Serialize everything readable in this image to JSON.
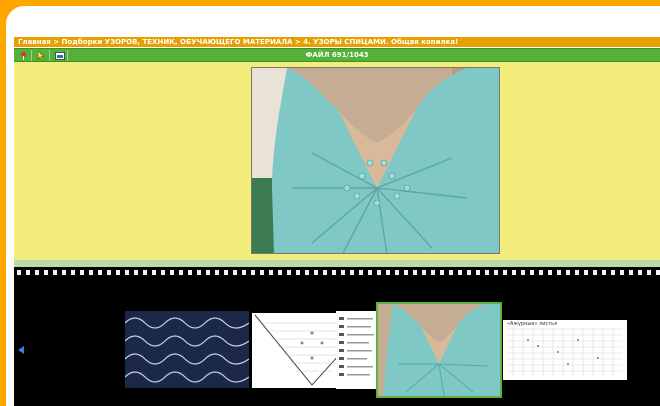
{
  "breadcrumb": {
    "home": "Главная",
    "section": "Подборки УЗОРОВ, ТЕХНИК, ОБУЧАЮЩЕГО МАТЕРИАЛА",
    "subsection": "4. УЗОРЫ СПИЦАМИ. Общая копилка!",
    "separator": ">"
  },
  "toolbar": {
    "file_counter": "ФАЙЛ 691/1043",
    "icons": [
      "pin-icon",
      "cursor-icon",
      "image-icon"
    ]
  },
  "colors": {
    "orange": "#ffa500",
    "green": "#55b13a",
    "viewer_bg": "#f3ed7c",
    "film_bg": "#000000",
    "active_thumb": "#5fb53c"
  },
  "main_image": {
    "subject": "knitted-top-photo"
  },
  "thumbnails": [
    {
      "name": "thumb-dark-lace",
      "active": false
    },
    {
      "name": "thumb-lace-chart",
      "active": false
    },
    {
      "name": "thumb-stitch-legend",
      "active": false
    },
    {
      "name": "thumb-knitted-top",
      "active": true
    },
    {
      "name": "thumb-leaves-chart",
      "active": false,
      "caption": "«Ажурные» листья"
    }
  ]
}
